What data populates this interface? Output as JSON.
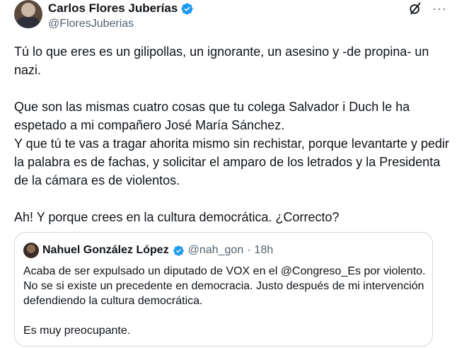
{
  "author": {
    "name": "Carlos Flores Juberías",
    "handle": "@FloresJuberias",
    "verified_icon": "verified-badge-icon"
  },
  "actions": {
    "grok_icon": "grok-icon",
    "more_icon": "more-options-icon",
    "more_label": "···"
  },
  "tweet": {
    "paragraph_1": "Tú lo que eres es un gilipollas, un ignorante, un asesino y -de propina- un nazi.",
    "paragraph_2a": "Que son las mismas cuatro cosas que tu colega Salvador i Duch le ha espetado a mi compañero José María Sánchez.",
    "paragraph_2b": "Y que tú te vas a tragar ahorita mismo sin rechistar, porque levantarte y pedir la palabra es de fachas, y solicitar el amparo de los letrados y la Presidenta de la cámara es de violentos.",
    "paragraph_3": "Ah! Y porque crees en la cultura democrática. ¿Correcto?"
  },
  "quoted": {
    "name": "Nahuel González López",
    "handle": "@nah_gon",
    "separator": "·",
    "time": "18h",
    "text_1": "Acaba de ser expulsado un diputado de VOX en el @Congreso_Es por violento. No se si existe un precedente en democracia. Justo después de mi intervención defendiendo la cultura democrática.",
    "text_2": "Es muy preocupante."
  },
  "colors": {
    "text": "#0f1419",
    "secondary": "#536471",
    "verified": "#1d9bf0",
    "border": "#cfd9de"
  }
}
